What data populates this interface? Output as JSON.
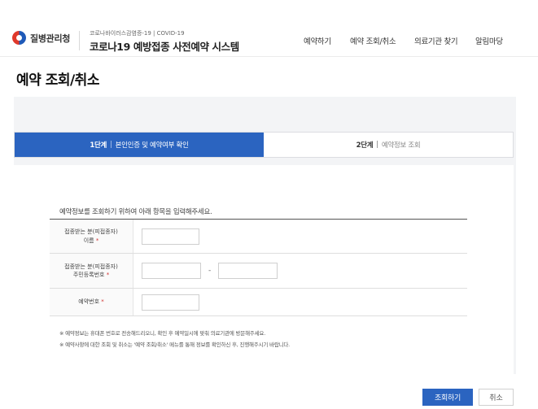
{
  "header": {
    "logo_text": "질병관리청",
    "system_sub": "코로나바이러스감염증-19 | COVID-19",
    "system_title": "코로나19 예방접종 사전예약 시스템",
    "nav": [
      "예약하기",
      "예약 조회/취소",
      "의료기관 찾기",
      "알림마당"
    ]
  },
  "page_title": "예약 조회/취소",
  "steps": [
    {
      "num": "1단계",
      "desc": "본인인증 및 예약여부 확인",
      "active": true
    },
    {
      "num": "2단계",
      "desc": "예약정보 조회",
      "active": false
    }
  ],
  "guide_text": "예약정보를 조회하기 위하여 아래 항목을 입력해주세요.",
  "form": {
    "name_label_1": "접종받는 분(피접종자)",
    "name_label_2": "이름",
    "rrn_label_1": "접종받는 분(피접종자)",
    "rrn_label_2": "주민등록번호",
    "rrn_dash": "-",
    "resv_label": "예약번호",
    "required_mark": "*",
    "name_value": "",
    "rrn_front_value": "",
    "rrn_back_value": "",
    "resv_value": ""
  },
  "notes": [
    "※ 예약정보는 휴대폰 번호로 전송해드리오니, 확인 후 예약일시에 맞춰 의료기관에 방문해주세요.",
    "※ 예약사항에 대한 조회 및 취소는 '예약 조회/취소' 메뉴를 통해 정보를 확인하신 후, 진행해주시기 바랍니다."
  ],
  "buttons": {
    "search": "조회하기",
    "cancel": "취소"
  },
  "colors": {
    "accent": "#2b64c0",
    "required": "#d0302f"
  }
}
